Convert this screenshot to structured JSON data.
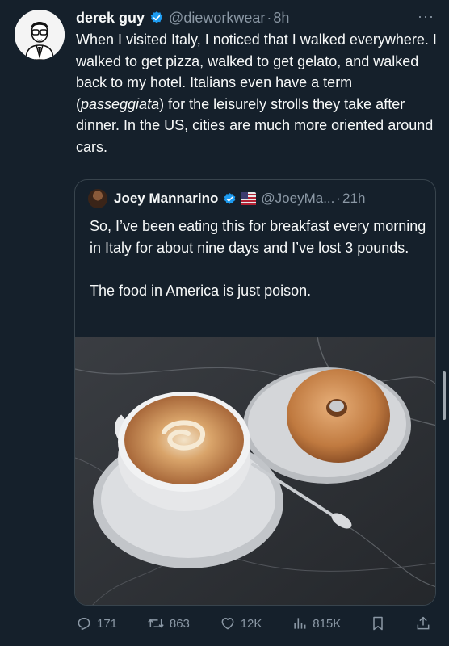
{
  "tweet": {
    "author_name": "derek guy",
    "author_handle": "@dieworkwear",
    "separator": "·",
    "time": "8h",
    "more": "···",
    "text_before": "When I visited Italy, I noticed that I walked everywhere. I walked to get pizza, walked to get gelato, and walked back to my hotel. Italians even have a  term (",
    "text_italic": "passeggiata",
    "text_after": ") for the leisurely strolls they take after dinner. In the US, cities are much more oriented around cars."
  },
  "quote": {
    "author_name": "Joey Mannarino",
    "author_handle": "@JoeyMa...",
    "separator": "·",
    "time": "21h",
    "text": "So, I’ve been eating this for breakfast every morning in Italy for about nine days and I’ve lost 3 pounds.\n\nThe food in America is just poison."
  },
  "actions": {
    "replies": "171",
    "reposts": "863",
    "likes": "12K",
    "views": "815K"
  },
  "colors": {
    "background": "#15202b",
    "verified": "#1d9bf0",
    "muted": "#8b98a5",
    "border": "#38444d"
  }
}
